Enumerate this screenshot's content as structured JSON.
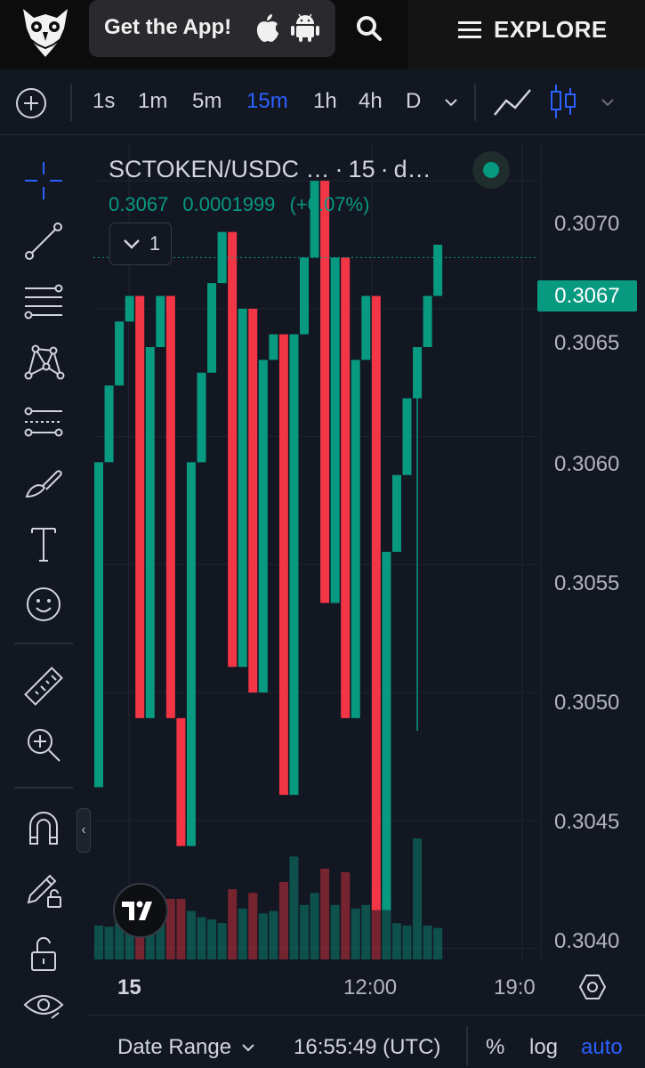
{
  "topbar": {
    "app_label": "Get the App!",
    "explore_label": "EXPLORE",
    "colors": {
      "background": "#0c0c0c",
      "pill": "#2a2a2e"
    }
  },
  "toolbar": {
    "intervals": [
      "1s",
      "1m",
      "5m",
      "15m",
      "1h",
      "4h",
      "D"
    ],
    "active_interval": "15m",
    "chart_type": "candles",
    "icons": [
      "add-icon",
      "chevron-down-icon",
      "line-chart-icon",
      "candlestick-icon",
      "chevron-down-icon"
    ]
  },
  "drawing_tools": [
    "crosshair-icon",
    "trend-line-icon",
    "fib-retracement-icon",
    "pattern-icon",
    "prediction-icon",
    "brush-icon",
    "text-icon",
    "emoji-icon",
    "ruler-icon",
    "zoom-in-icon",
    "magnet-icon",
    "lock-drawing-icon",
    "unlock-icon",
    "eye-icon"
  ],
  "legend": {
    "symbol": "SCTOKEN/USDC …",
    "interval": "15",
    "exchange": "d…",
    "last_price": "0.3067",
    "change": "0.0001999",
    "change_pct": "(+0.07%)",
    "indicators_count": "1"
  },
  "price_axis": {
    "labels": [
      "0.3070",
      "0.3065",
      "0.3060",
      "0.3055",
      "0.3050",
      "0.3045",
      "0.3040"
    ],
    "current_price_badge": "0.3067"
  },
  "time_axis": {
    "labels": [
      "15",
      "12:00",
      "19:0"
    ]
  },
  "bottombar": {
    "date_range_label": "Date Range",
    "clock": "16:55:49 (UTC)",
    "percent_label": "%",
    "log_label": "log",
    "auto_label": "auto"
  },
  "colors": {
    "up": "#089981",
    "down": "#f23645",
    "accent": "#2962ff",
    "background": "#131722"
  },
  "chart_data": {
    "type": "candlestick",
    "interval": "15",
    "ylim": [
      0.30395,
      0.30715
    ],
    "candles": [
      {
        "o": 0.30463,
        "c": 0.3059,
        "v": 0.28
      },
      {
        "o": 0.3059,
        "c": 0.3062,
        "v": 0.27
      },
      {
        "o": 0.3062,
        "c": 0.30645,
        "v": 0.3
      },
      {
        "o": 0.30645,
        "c": 0.30655,
        "v": 0.32
      },
      {
        "o": 0.30655,
        "c": 0.3049,
        "v": 0.5
      },
      {
        "o": 0.3049,
        "c": 0.30635,
        "v": 0.33
      },
      {
        "o": 0.30635,
        "c": 0.30655,
        "v": 0.35
      },
      {
        "o": 0.30655,
        "c": 0.3049,
        "v": 0.5
      },
      {
        "o": 0.3049,
        "c": 0.3044,
        "v": 0.5
      },
      {
        "o": 0.3044,
        "c": 0.3059,
        "v": 0.4
      },
      {
        "o": 0.3059,
        "c": 0.30625,
        "v": 0.35
      },
      {
        "o": 0.30625,
        "c": 0.3066,
        "v": 0.33
      },
      {
        "o": 0.3066,
        "c": 0.3068,
        "v": 0.3
      },
      {
        "o": 0.3068,
        "c": 0.3051,
        "v": 0.58
      },
      {
        "o": 0.3051,
        "c": 0.3065,
        "v": 0.42
      },
      {
        "o": 0.3065,
        "c": 0.305,
        "v": 0.55
      },
      {
        "o": 0.305,
        "c": 0.3063,
        "v": 0.38
      },
      {
        "o": 0.3063,
        "c": 0.3064,
        "v": 0.4
      },
      {
        "o": 0.3064,
        "c": 0.3046,
        "v": 0.64
      },
      {
        "o": 0.3046,
        "c": 0.3064,
        "v": 0.85
      },
      {
        "o": 0.3064,
        "c": 0.3067,
        "v": 0.45
      },
      {
        "o": 0.3067,
        "c": 0.307,
        "v": 0.55
      },
      {
        "o": 0.307,
        "c": 0.30535,
        "v": 0.75
      },
      {
        "o": 0.30535,
        "c": 0.3067,
        "v": 0.45
      },
      {
        "o": 0.3067,
        "c": 0.3049,
        "v": 0.72
      },
      {
        "o": 0.3049,
        "c": 0.3063,
        "v": 0.42
      },
      {
        "o": 0.3063,
        "c": 0.30655,
        "v": 0.45
      },
      {
        "o": 0.30655,
        "c": 0.30415,
        "v": 0.6
      },
      {
        "o": 0.30415,
        "c": 0.30555,
        "v": 0.47
      },
      {
        "o": 0.30555,
        "c": 0.30585,
        "v": 0.3
      },
      {
        "o": 0.30585,
        "c": 0.30615,
        "v": 0.28
      },
      {
        "o": 0.30615,
        "c": 0.30635,
        "v": 1.0,
        "l": 0.30485
      },
      {
        "o": 0.30635,
        "c": 0.30655,
        "v": 0.28
      },
      {
        "o": 0.30655,
        "c": 0.30675,
        "v": 0.26
      }
    ]
  }
}
